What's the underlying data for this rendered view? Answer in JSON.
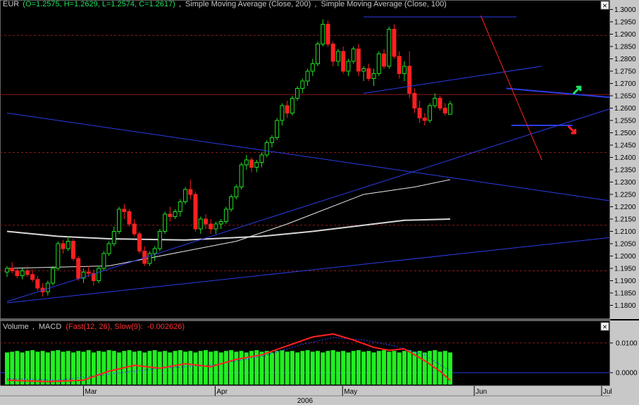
{
  "chart_data": [
    {
      "type": "candlestick",
      "symbol": "EUR",
      "legend": {
        "symbol": "EUR",
        "ohlc": "(O=1.2575, H=1.2629, L=1.2574, C=1.2617)",
        "ma1": "Simple Moving Average (Close, 200)",
        "ma2": "Simple Moving Average (Close, 100)",
        "sep": ",",
        "close_button": "×"
      },
      "ylim": [
        1.177,
        1.301
      ],
      "y_ticks": [
        "1.3000",
        "1.2950",
        "1.2900",
        "1.2850",
        "1.2800",
        "1.2750",
        "1.2700",
        "1.2650",
        "1.2600",
        "1.2550",
        "1.2500",
        "1.2450",
        "1.2400",
        "1.2350",
        "1.2300",
        "1.2250",
        "1.2200",
        "1.2150",
        "1.2100",
        "1.2050",
        "1.2000",
        "1.1950",
        "1.1900",
        "1.1850",
        "1.1800"
      ],
      "x_range_days": [
        0,
        143
      ],
      "months": [
        {
          "label": "Mar",
          "day": 19
        },
        {
          "label": "Apr",
          "day": 50
        },
        {
          "label": "May",
          "day": 80
        },
        {
          "label": "Jun",
          "day": 111
        },
        {
          "label": "Jul",
          "day": 141
        }
      ],
      "year_label": "2006",
      "reference_lines": [
        1.2895,
        1.2655,
        1.242,
        1.2125,
        1.194
      ],
      "candles": [
        [
          0,
          1.1935,
          1.196,
          1.1915,
          1.195
        ],
        [
          1,
          1.195,
          1.1975,
          1.193,
          1.194
        ],
        [
          2,
          1.194,
          1.1955,
          1.191,
          1.192
        ],
        [
          3,
          1.192,
          1.195,
          1.1905,
          1.194
        ],
        [
          4,
          1.194,
          1.196,
          1.1915,
          1.1925
        ],
        [
          5,
          1.1925,
          1.1945,
          1.1895,
          1.1905
        ],
        [
          6,
          1.1905,
          1.192,
          1.186,
          1.187
        ],
        [
          7,
          1.187,
          1.189,
          1.1835,
          1.1855
        ],
        [
          8,
          1.1855,
          1.19,
          1.184,
          1.189
        ],
        [
          9,
          1.189,
          1.196,
          1.188,
          1.195
        ],
        [
          10,
          1.195,
          1.206,
          1.194,
          1.205
        ],
        [
          11,
          1.205,
          1.2065,
          1.201,
          1.203
        ],
        [
          12,
          1.203,
          1.208,
          1.202,
          1.206
        ],
        [
          13,
          1.206,
          1.207,
          1.198,
          1.199
        ],
        [
          14,
          1.199,
          1.2,
          1.19,
          1.191
        ],
        [
          15,
          1.191,
          1.195,
          1.189,
          1.1935
        ],
        [
          16,
          1.1935,
          1.196,
          1.1915,
          1.193
        ],
        [
          17,
          1.193,
          1.1945,
          1.188,
          1.19
        ],
        [
          18,
          1.19,
          1.196,
          1.189,
          1.195
        ],
        [
          19,
          1.195,
          1.202,
          1.194,
          1.201
        ],
        [
          20,
          1.201,
          1.206,
          1.2,
          1.205
        ],
        [
          21,
          1.205,
          1.212,
          1.204,
          1.21
        ],
        [
          22,
          1.21,
          1.22,
          1.209,
          1.219
        ],
        [
          23,
          1.219,
          1.221,
          1.215,
          1.218
        ],
        [
          24,
          1.218,
          1.219,
          1.212,
          1.213
        ],
        [
          25,
          1.213,
          1.215,
          1.208,
          1.209
        ],
        [
          26,
          1.209,
          1.21,
          1.201,
          1.202
        ],
        [
          27,
          1.202,
          1.204,
          1.196,
          1.197
        ],
        [
          28,
          1.197,
          1.202,
          1.196,
          1.201
        ],
        [
          29,
          1.201,
          1.204,
          1.198,
          1.203
        ],
        [
          30,
          1.203,
          1.211,
          1.202,
          1.21
        ],
        [
          31,
          1.21,
          1.218,
          1.209,
          1.217
        ],
        [
          32,
          1.217,
          1.22,
          1.214,
          1.216
        ],
        [
          33,
          1.216,
          1.219,
          1.215,
          1.218
        ],
        [
          34,
          1.218,
          1.223,
          1.216,
          1.222
        ],
        [
          35,
          1.222,
          1.228,
          1.221,
          1.227
        ],
        [
          36,
          1.227,
          1.231,
          1.223,
          1.225
        ],
        [
          37,
          1.225,
          1.226,
          1.21,
          1.211
        ],
        [
          38,
          1.211,
          1.216,
          1.209,
          1.215
        ],
        [
          39,
          1.215,
          1.217,
          1.211,
          1.213
        ],
        [
          40,
          1.213,
          1.215,
          1.209,
          1.211
        ],
        [
          41,
          1.211,
          1.214,
          1.209,
          1.213
        ],
        [
          42,
          1.213,
          1.215,
          1.211,
          1.214
        ],
        [
          43,
          1.214,
          1.22,
          1.213,
          1.219
        ],
        [
          44,
          1.219,
          1.225,
          1.218,
          1.224
        ],
        [
          45,
          1.224,
          1.229,
          1.223,
          1.228
        ],
        [
          46,
          1.228,
          1.238,
          1.227,
          1.237
        ],
        [
          47,
          1.237,
          1.241,
          1.235,
          1.239
        ],
        [
          48,
          1.239,
          1.24,
          1.234,
          1.236
        ],
        [
          49,
          1.236,
          1.239,
          1.234,
          1.238
        ],
        [
          50,
          1.238,
          1.242,
          1.236,
          1.241
        ],
        [
          51,
          1.241,
          1.247,
          1.24,
          1.246
        ],
        [
          52,
          1.246,
          1.249,
          1.244,
          1.248
        ],
        [
          53,
          1.248,
          1.256,
          1.247,
          1.255
        ],
        [
          54,
          1.255,
          1.262,
          1.253,
          1.261
        ],
        [
          55,
          1.261,
          1.263,
          1.256,
          1.258
        ],
        [
          56,
          1.258,
          1.265,
          1.257,
          1.264
        ],
        [
          57,
          1.264,
          1.269,
          1.263,
          1.268
        ],
        [
          58,
          1.268,
          1.272,
          1.266,
          1.271
        ],
        [
          59,
          1.271,
          1.276,
          1.269,
          1.275
        ],
        [
          60,
          1.275,
          1.28,
          1.273,
          1.278
        ],
        [
          61,
          1.278,
          1.287,
          1.277,
          1.286
        ],
        [
          62,
          1.286,
          1.296,
          1.285,
          1.294
        ],
        [
          63,
          1.294,
          1.2955,
          1.285,
          1.286
        ],
        [
          64,
          1.286,
          1.287,
          1.277,
          1.279
        ],
        [
          65,
          1.279,
          1.284,
          1.277,
          1.283
        ],
        [
          66,
          1.283,
          1.285,
          1.274,
          1.275
        ],
        [
          67,
          1.275,
          1.28,
          1.273,
          1.279
        ],
        [
          68,
          1.279,
          1.285,
          1.278,
          1.284
        ],
        [
          69,
          1.284,
          1.286,
          1.273,
          1.275
        ],
        [
          70,
          1.275,
          1.277,
          1.271,
          1.276
        ],
        [
          71,
          1.276,
          1.278,
          1.271,
          1.272
        ],
        [
          72,
          1.272,
          1.276,
          1.269,
          1.274
        ],
        [
          73,
          1.274,
          1.283,
          1.273,
          1.282
        ],
        [
          74,
          1.282,
          1.284,
          1.276,
          1.277
        ],
        [
          75,
          1.277,
          1.293,
          1.276,
          1.292
        ],
        [
          76,
          1.292,
          1.294,
          1.28,
          1.281
        ],
        [
          77,
          1.281,
          1.283,
          1.272,
          1.274
        ],
        [
          78,
          1.274,
          1.279,
          1.271,
          1.277
        ],
        [
          79,
          1.277,
          1.283,
          1.264,
          1.266
        ],
        [
          80,
          1.266,
          1.268,
          1.258,
          1.26
        ],
        [
          81,
          1.26,
          1.263,
          1.254,
          1.256
        ],
        [
          82,
          1.256,
          1.258,
          1.253,
          1.255
        ],
        [
          83,
          1.255,
          1.262,
          1.254,
          1.261
        ],
        [
          84,
          1.261,
          1.266,
          1.26,
          1.264
        ],
        [
          85,
          1.264,
          1.265,
          1.259,
          1.26
        ],
        [
          86,
          1.26,
          1.262,
          1.257,
          1.258
        ],
        [
          87,
          1.2575,
          1.2629,
          1.2574,
          1.2617
        ]
      ],
      "sma100": [
        [
          0,
          1.195
        ],
        [
          20,
          1.196
        ],
        [
          35,
          1.202
        ],
        [
          45,
          1.206
        ],
        [
          55,
          1.213
        ],
        [
          60,
          1.217
        ],
        [
          70,
          1.225
        ],
        [
          80,
          1.228
        ],
        [
          87,
          1.231
        ]
      ],
      "sma200": [
        [
          0,
          1.21
        ],
        [
          10,
          1.208
        ],
        [
          20,
          1.207
        ],
        [
          35,
          1.2065
        ],
        [
          50,
          1.208
        ],
        [
          60,
          1.21
        ],
        [
          70,
          1.2125
        ],
        [
          78,
          1.2145
        ],
        [
          87,
          1.215
        ]
      ],
      "trendlines": [
        {
          "color": "#2b3ce6",
          "width": 1,
          "points": [
            [
              0,
              1.1815
            ],
            [
              143,
              1.276
            ]
          ]
        },
        {
          "color": "#2b3ce6",
          "width": 1,
          "points": [
            [
              0,
              1.258
            ],
            [
              143,
              1.215
            ]
          ]
        },
        {
          "color": "#2b3ce6",
          "width": 1,
          "points": [
            [
              0,
              1.181
            ],
            [
              143,
              1.213
            ]
          ]
        },
        {
          "color": "#2b3ce6",
          "width": 1,
          "points": [
            [
              70,
              1.297
            ],
            [
              100,
              1.297
            ]
          ]
        },
        {
          "color": "#2b3ce6",
          "width": 1,
          "points": [
            [
              70,
              1.266
            ],
            [
              105,
              1.277
            ]
          ]
        },
        {
          "color": "#2b3ce6",
          "width": 2,
          "points": [
            [
              98,
              1.268
            ],
            [
              126,
              1.263
            ]
          ]
        },
        {
          "color": "#2b3ce6",
          "width": 2,
          "points": [
            [
              99,
              1.253
            ],
            [
              111,
              1.253
            ]
          ]
        },
        {
          "color": "#ff2020",
          "width": 1,
          "points": [
            [
              93,
              1.2975
            ],
            [
              105,
              1.239
            ]
          ]
        }
      ],
      "arrows": [
        {
          "color": "#22e060",
          "day": 112,
          "value": 1.2675,
          "dir": "up"
        },
        {
          "color": "#ff2020",
          "day": 111,
          "value": 1.251,
          "dir": "down"
        }
      ]
    },
    {
      "type": "bar+line",
      "legend": {
        "volume": "Volume",
        "sep": ",",
        "macd_name": "MACD",
        "macd_params": "(Fast(12, 26), Slow(9):",
        "macd_value": "-0.002626)"
      },
      "ylim": [
        -0.004,
        0.014
      ],
      "y_ticks": [
        "0.0100",
        "0.0000"
      ],
      "grid": [
        0.01,
        0.0
      ],
      "volume": [
        42,
        43,
        44,
        42,
        44,
        45,
        43,
        44,
        42,
        44,
        45,
        43,
        44,
        42,
        44,
        43,
        45,
        42,
        44,
        43,
        45,
        44,
        42,
        44,
        45,
        43,
        44,
        42,
        44,
        45,
        43,
        44,
        42,
        44,
        45,
        43,
        44,
        42,
        44,
        45,
        43,
        44,
        42,
        44,
        45,
        43,
        44,
        42,
        44,
        45,
        43,
        44,
        42,
        44,
        45,
        43,
        44,
        42,
        44,
        45,
        43,
        44,
        42,
        44,
        45,
        43,
        44,
        42,
        44,
        45,
        43,
        44,
        42,
        44,
        45,
        43,
        44,
        42,
        44,
        45,
        43,
        44,
        42,
        44,
        45,
        43,
        44,
        42
      ],
      "volume_max": 70,
      "macd": [
        [
          0,
          -0.0025
        ],
        [
          8,
          -0.003
        ],
        [
          15,
          -0.0025
        ],
        [
          20,
          0.0005
        ],
        [
          25,
          0.0025
        ],
        [
          30,
          0.0015
        ],
        [
          35,
          0.003
        ],
        [
          40,
          0.002
        ],
        [
          45,
          0.0045
        ],
        [
          50,
          0.006
        ],
        [
          55,
          0.009
        ],
        [
          60,
          0.012
        ],
        [
          64,
          0.013
        ],
        [
          68,
          0.011
        ],
        [
          72,
          0.0085
        ],
        [
          75,
          0.0075
        ],
        [
          78,
          0.008
        ],
        [
          82,
          0.004
        ],
        [
          85,
          0.0005
        ],
        [
          87,
          -0.0026
        ]
      ],
      "signal": [
        [
          0,
          -0.002
        ],
        [
          10,
          -0.0025
        ],
        [
          20,
          -0.0005
        ],
        [
          30,
          0.0015
        ],
        [
          40,
          0.0025
        ],
        [
          50,
          0.0055
        ],
        [
          58,
          0.0095
        ],
        [
          64,
          0.0118
        ],
        [
          70,
          0.011
        ],
        [
          76,
          0.009
        ],
        [
          82,
          0.006
        ],
        [
          87,
          0.0005
        ]
      ]
    }
  ]
}
